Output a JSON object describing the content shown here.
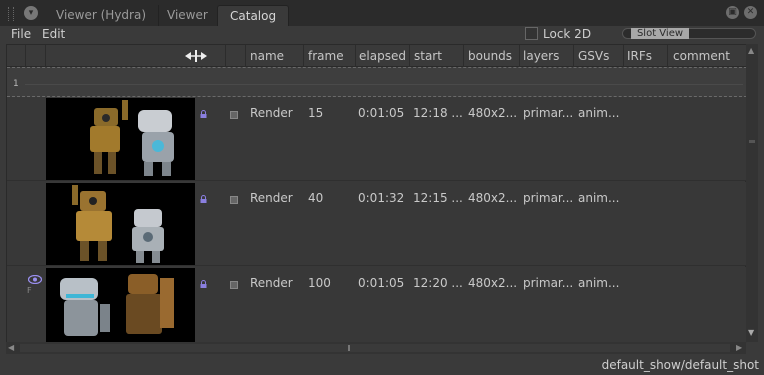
{
  "tabs": [
    {
      "label": "Viewer (Hydra)"
    },
    {
      "label": "Viewer"
    },
    {
      "label": "Catalog",
      "active": true
    }
  ],
  "menubar": {
    "file": "File",
    "edit": "Edit"
  },
  "toolbar": {
    "lock_2d_label": "Lock 2D",
    "lock_2d_checked": false,
    "slot_view_label": "Slot View"
  },
  "columns": [
    "name",
    "frame",
    "elapsed",
    "start",
    "bounds",
    "layers",
    "GSVs",
    "IRFs",
    "comment"
  ],
  "group": {
    "label": "1"
  },
  "rows": [
    {
      "name": "Render",
      "frame": "15",
      "elapsed": "0:01:05",
      "start": "12:18 ...",
      "bounds": "480x2...",
      "layers": "primar...",
      "gsvs": "anim...",
      "irfs": "",
      "comment": ""
    },
    {
      "name": "Render",
      "frame": "40",
      "elapsed": "0:01:32",
      "start": "12:15 ...",
      "bounds": "480x2...",
      "layers": "primar...",
      "gsvs": "anim...",
      "irfs": "",
      "comment": ""
    },
    {
      "name": "Render",
      "frame": "100",
      "elapsed": "0:01:05",
      "start": "12:20 ...",
      "bounds": "480x2...",
      "layers": "primar...",
      "gsvs": "anim...",
      "irfs": "",
      "comment": "",
      "viewing": true,
      "flag": "F"
    }
  ],
  "status": {
    "path": "default_show/default_shot"
  },
  "colors": {
    "background": "#3a3a3a",
    "tabbar": "#2b2b2b",
    "lock_icon": "#8a7fe0",
    "thumb_bg": "#000000"
  },
  "icons": [
    "pane-grip-icon",
    "pane-menu-icon",
    "float-icon",
    "close-icon",
    "resize-cursor-icon",
    "lock-icon",
    "disk-icon",
    "eye-icon"
  ]
}
